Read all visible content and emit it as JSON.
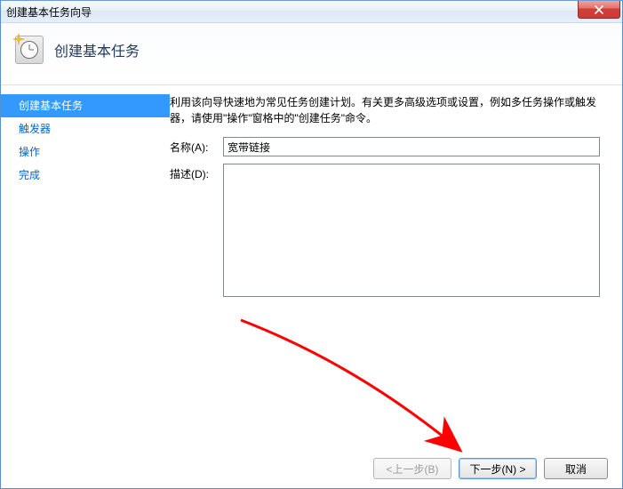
{
  "window": {
    "title": "创建基本任务向导"
  },
  "header": {
    "heading": "创建基本任务"
  },
  "sidebar": {
    "items": [
      {
        "label": "创建基本任务",
        "selected": true
      },
      {
        "label": "触发器",
        "selected": false
      },
      {
        "label": "操作",
        "selected": false
      },
      {
        "label": "完成",
        "selected": false
      }
    ]
  },
  "main": {
    "intro": "利用该向导快速地为常见任务创建计划。有关更多高级选项或设置，例如多任务操作或触发器，请使用\"操作\"窗格中的\"创建任务\"命令。",
    "name_label": "名称(A):",
    "name_value": "宽带链接",
    "desc_label": "描述(D):",
    "desc_value": ""
  },
  "buttons": {
    "back": "<上一步(B)",
    "next": "下一步(N) >",
    "cancel": "取消"
  }
}
